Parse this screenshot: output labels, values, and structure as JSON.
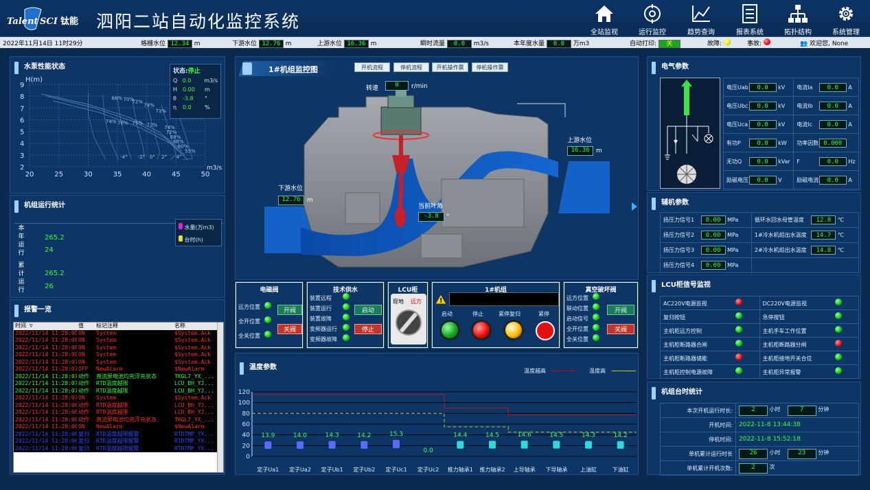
{
  "header": {
    "logo_text": "Talent SCI 钛能",
    "title": "泗阳二站自动化监控系统",
    "nav": [
      {
        "label": "全站监视",
        "icon": "home-icon"
      },
      {
        "label": "运行监控",
        "icon": "target-icon"
      },
      {
        "label": "趋势查询",
        "icon": "trend-icon"
      },
      {
        "label": "报表系统",
        "icon": "report-icon"
      },
      {
        "label": "拓扑结构",
        "icon": "topology-icon"
      },
      {
        "label": "系统管理",
        "icon": "gear-icon"
      }
    ]
  },
  "infobar": {
    "datetime": "2022年11月14日 11时29分",
    "gate_level_label": "格栅水位",
    "gate_level": "12.34",
    "gate_unit": "m",
    "down_label": "下游水位",
    "down_level": "12.76",
    "down_unit": "m",
    "up_label": "上游水位",
    "up_level": "16.36",
    "up_unit": "m",
    "flow_label": "瞬时流量",
    "flow": "0.0",
    "flow_unit": "m3/s",
    "year_label": "本年度水量",
    "year_water": "0.0",
    "year_unit": "万m3",
    "print_label": "自动打印:",
    "print_state": "关",
    "fault_label": "故障:",
    "event_label": "事故:",
    "welcome": "欢迎您, None"
  },
  "pump": {
    "title": "水泵性能状态",
    "status_label": "状态:",
    "status": "停止",
    "params": [
      {
        "k": "Q",
        "v": "0.0",
        "u": "m3/s"
      },
      {
        "k": "H",
        "v": "0.00",
        "u": "m"
      },
      {
        "k": "θ",
        "v": "-3.8",
        "u": "°"
      },
      {
        "k": "η",
        "v": "0.0",
        "u": "%"
      }
    ],
    "chart_data": {
      "type": "line",
      "ylabel": "H(m)",
      "xlabel": "m3/s",
      "x_ticks": [
        "20",
        "25",
        "30",
        "35",
        "40",
        "45",
        "50"
      ],
      "y_ticks": [
        "2",
        "3",
        "4",
        "5",
        "6",
        "7",
        "8",
        "9"
      ],
      "xlim": [
        20,
        50
      ],
      "ylim": [
        2,
        9
      ],
      "annotations": [
        "68%",
        "70%",
        "72%",
        "74%",
        "73%",
        "74%",
        "76%",
        "75%",
        "72%",
        "74%",
        "72%",
        "68%",
        "68%",
        "60%",
        "55%",
        "-4°",
        "-2°",
        "0°",
        "2°",
        "4°"
      ]
    }
  },
  "stats": {
    "title": "机组运行统计",
    "year_label": "本年运行",
    "total_label": "累计运行",
    "year_water": "265.2",
    "year_hours": "24",
    "total_water": "265.2",
    "total_hours": "26",
    "legend_water": "水量(万m3)",
    "legend_hours": "台时(h)"
  },
  "alarms": {
    "title": "报警一览",
    "cols": [
      "时间 ▽",
      "值",
      "标记注释",
      "名称"
    ],
    "rows": [
      {
        "t": "2022/11/14 11:28:09",
        "v": "ON",
        "n": "System",
        "name": "$System.Ack",
        "c": "#ff2a2a"
      },
      {
        "t": "2022/11/14 11:28:08",
        "v": "ON",
        "n": "System",
        "name": "$System.Ack",
        "c": "#ff2a2a"
      },
      {
        "t": "2022/11/14 11:28:08",
        "v": "ON",
        "n": "System",
        "name": "$System.Ack",
        "c": "#ff2a2a"
      },
      {
        "t": "2022/11/14 11:28:08",
        "v": "ON",
        "n": "System",
        "name": "$System.Ack",
        "c": "#ff2a2a"
      },
      {
        "t": "2022/11/14 11:28:07",
        "v": "ON",
        "n": "System",
        "name": "$System.Ack",
        "c": "#ff2a2a"
      },
      {
        "t": "2022/11/14 11:28:07",
        "v": "OFF",
        "n": "NewAlarm",
        "name": "$NewAlarm",
        "c": "#ff2a2a"
      },
      {
        "t": "2022/11/14 11:28:07",
        "v": "动作",
        "n": "直流屏电池均充浮充状态",
        "name": "TKGL7_YX_...",
        "c": "#2aff2a"
      },
      {
        "t": "2022/11/14 11:28:07",
        "v": "动作",
        "n": "RTD温度越限",
        "name": "LCU_BH_YJ...",
        "c": "#2aff2a"
      },
      {
        "t": "2022/11/14 11:28:07",
        "v": "动作",
        "n": "RTD温度越限",
        "name": "LCU_BH_YJ...",
        "c": "#2aff2a"
      },
      {
        "t": "2022/11/14 11:28:07",
        "v": "ON",
        "n": "System",
        "name": "$System.Ack",
        "c": "#ff2a2a"
      },
      {
        "t": "2022/11/14 11:28:06",
        "v": "动作",
        "n": "RTD温度越限",
        "name": "LCU_BH_YJ...",
        "c": "#ff2a2a"
      },
      {
        "t": "2022/11/14 11:28:06",
        "v": "动作",
        "n": "RTD温度越限",
        "name": "LCU_BH_YJ...",
        "c": "#ff2a2a"
      },
      {
        "t": "2022/11/14 11:28:06",
        "v": "动作",
        "n": "直流屏电池均充浮充状态",
        "name": "TKGL7_YX_...",
        "c": "#ff2a2a"
      },
      {
        "t": "2022/11/14 11:28:06",
        "v": "ON",
        "n": "NewAlarm",
        "name": "$NewAlarm",
        "c": "#ff2a2a"
      },
      {
        "t": "2022/11/14 11:28:06",
        "v": "复归",
        "n": "RTD温度越限报警",
        "name": "RTDTMP_YX...",
        "c": "#2a4aff"
      },
      {
        "t": "2022/11/14 11:28:06",
        "v": "复归",
        "n": "RTD温度越限报警",
        "name": "RTDTMP_YX...",
        "c": "#2a4aff"
      },
      {
        "t": "2022/11/14 11:28:06",
        "v": "复归",
        "n": "RTD温度越限报警",
        "name": "RTDTMP_YX...",
        "c": "#2a4aff"
      }
    ]
  },
  "unit": {
    "title": "1#机组监控图",
    "buttons": [
      "开机流程",
      "停机流程",
      "开机操作票",
      "停机操作票"
    ],
    "speed_label": "转速",
    "speed": "0",
    "speed_unit": "r/min",
    "up_label": "上游水位",
    "up": "16.36",
    "down_label": "下游水位",
    "down": "12.76",
    "unit_m": "m",
    "blade_label": "当前叶角",
    "blade": "-3.8",
    "blade_unit": "°"
  },
  "ctrl": {
    "valve_title": "电磁阀",
    "valve_rows": [
      "远方位置",
      "全开位置",
      "全关位置"
    ],
    "valve_open": "开阀",
    "valve_close": "关阀",
    "water_title": "技术供水",
    "water_rows": [
      "装置远程",
      "装置运行",
      "装置故障",
      "变频器运行",
      "变频器故障"
    ],
    "water_start": "启动",
    "water_stop": "停止",
    "lcu_title": "LCU柜",
    "lcu_local": "现地",
    "lcu_remote": "远方",
    "unit_title": "1#机组",
    "unit_btns": [
      "启动",
      "停止",
      "紧停复归",
      "紧停"
    ],
    "vac_title": "真空破坏阀",
    "vac_rows": [
      "远方位置",
      "联动位置",
      "启动信号",
      "全开位置",
      "全关位置"
    ],
    "vac_open": "开阀",
    "vac_close": "关阀"
  },
  "temp": {
    "title": "温度参数",
    "legend_high2": "温度越高",
    "legend_high": "温度高",
    "chart_data": {
      "type": "bar",
      "categories": [
        "定子Ua1",
        "定子Ua2",
        "定子Ub1",
        "定子Ub2",
        "定子Uc1",
        "定子Uc2",
        "推力轴承1",
        "推力轴承2",
        "上导轴承",
        "下导轴承",
        "上油缸",
        "下油缸"
      ],
      "values": [
        13.9,
        14.0,
        14.3,
        14.2,
        15.3,
        0.0,
        14.4,
        14.5,
        14.6,
        14.5,
        14.3,
        14.2
      ],
      "value_labels": [
        "13.9",
        "14.0",
        "14.3",
        "14.2",
        "15.3",
        "0.0",
        "14.4",
        "14.5",
        "14.6",
        "14.5",
        "14.3",
        "14.2"
      ],
      "ylim": [
        0,
        120
      ],
      "y_ticks": [
        "0",
        "20",
        "40",
        "60",
        "80",
        "100",
        "120"
      ],
      "series": [
        {
          "name": "温度越高",
          "values": [
            115,
            115,
            115,
            115,
            115,
            115,
            90,
            90,
            77,
            77,
            77,
            77
          ]
        },
        {
          "name": "温度高",
          "values": [
            80,
            80,
            80,
            80,
            80,
            80,
            55,
            55,
            45,
            45,
            45,
            45
          ]
        }
      ]
    }
  },
  "elec": {
    "title": "电气参数",
    "rows": [
      [
        {
          "k": "电压Uab",
          "v": "0.0",
          "u": "kV"
        },
        {
          "k": "电流Ia",
          "v": "0.0",
          "u": "A"
        }
      ],
      [
        {
          "k": "电压Ubc",
          "v": "0.0",
          "u": "kV"
        },
        {
          "k": "电流Ib",
          "v": "0.0",
          "u": "A"
        }
      ],
      [
        {
          "k": "电压Uca",
          "v": "0.0",
          "u": "kV"
        },
        {
          "k": "电流Ic",
          "v": "0.0",
          "u": "A"
        }
      ],
      [
        {
          "k": "有功P",
          "v": "0.0",
          "u": "kW"
        },
        {
          "k": "功率因数",
          "v": "0.000",
          "u": ""
        }
      ],
      [
        {
          "k": "无功Q",
          "v": "0.0",
          "u": "kVar"
        },
        {
          "k": "F",
          "v": "0.0",
          "u": "Hz"
        }
      ],
      [
        {
          "k": "励磁电压",
          "v": "0.0",
          "u": "V"
        },
        {
          "k": "励磁电流",
          "v": "0.0",
          "u": "A"
        }
      ]
    ]
  },
  "aux": {
    "title": "辅机参数",
    "rows": [
      [
        {
          "k": "扬压力信号1",
          "v": "0.00",
          "u": "MPa"
        },
        {
          "k": "循环水回水母管温度",
          "v": "12.0",
          "u": "℃"
        }
      ],
      [
        {
          "k": "扬压力信号2",
          "v": "0.00",
          "u": "MPa"
        },
        {
          "k": "1#冷水机组出水温度",
          "v": "14.7",
          "u": "℃"
        }
      ],
      [
        {
          "k": "扬压力信号3",
          "v": "0.00",
          "u": "MPa"
        },
        {
          "k": "2#冷水机组出水温度",
          "v": "14.8",
          "u": "℃"
        }
      ],
      [
        {
          "k": "扬压力信号4",
          "v": "0.00",
          "u": "MPa"
        },
        {
          "k": "",
          "v": "",
          "u": ""
        }
      ]
    ]
  },
  "lcu": {
    "title": "LCU柜信号监视",
    "rows": [
      [
        {
          "k": "AC220V电源监视",
          "s": "r"
        },
        {
          "k": "DC220V电源监视",
          "s": "g"
        }
      ],
      [
        {
          "k": "复归按钮",
          "s": "g"
        },
        {
          "k": "急停按钮",
          "s": "g"
        }
      ],
      [
        {
          "k": "主机柜远方控制",
          "s": "g"
        },
        {
          "k": "主机手车工作位置",
          "s": "g"
        }
      ],
      [
        {
          "k": "主机柜断路器合闸",
          "s": "g"
        },
        {
          "k": "主机柜断路器分闸",
          "s": "r"
        }
      ],
      [
        {
          "k": "主机柜断路器储能",
          "s": "r"
        },
        {
          "k": "主机柜接地开关合位",
          "s": "g"
        }
      ],
      [
        {
          "k": "主机柜控制电源故障",
          "s": "g"
        },
        {
          "k": "主机柜异常报警",
          "s": "g"
        }
      ]
    ]
  },
  "runtime": {
    "title": "机组台时统计",
    "run_label": "本次开机运行时长:",
    "run_h": "2",
    "h_unit": "小时",
    "run_m": "7",
    "m_unit": "分钟",
    "start_label": "开机时间:",
    "start": "2022-11-8 13:44:38",
    "stop_label": "停机时间:",
    "stop": "2022-11-8 15:52:18",
    "total_label": "单机累计运行时长",
    "total_h": "26",
    "total_m": "23",
    "count_label": "单机累计开机次数:",
    "count": "2",
    "count_unit": "次"
  }
}
